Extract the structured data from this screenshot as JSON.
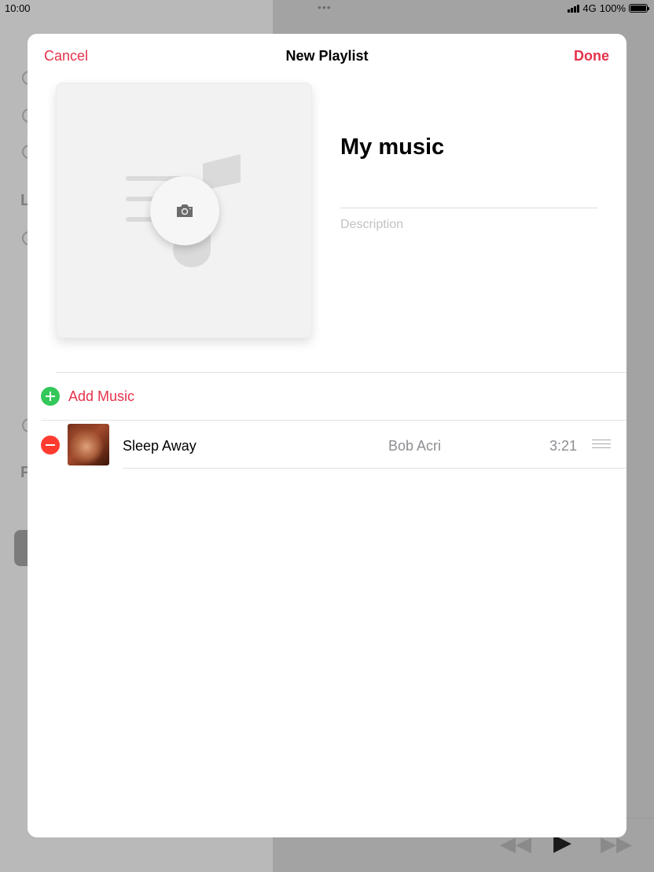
{
  "status_bar": {
    "time": "10:00",
    "dots": "•••",
    "network": "4G",
    "battery": "100%"
  },
  "background": {
    "sections": [
      "L",
      "P"
    ]
  },
  "modal": {
    "cancel_label": "Cancel",
    "title": "New Playlist",
    "done_label": "Done",
    "playlist_name": "My music",
    "description_placeholder": "Description",
    "add_music_label": "Add Music",
    "tracks": [
      {
        "title": "Sleep Away",
        "artist": "Bob Acri",
        "duration": "3:21"
      }
    ]
  },
  "colors": {
    "accent": "#e5324a",
    "add_green": "#34c759",
    "remove_red": "#ff3b30"
  },
  "icons": {
    "artwork_placeholder": "music-note-icon",
    "camera": "camera-icon",
    "add": "plus-circle-icon",
    "remove": "minus-circle-icon",
    "reorder": "drag-handle-icon"
  }
}
